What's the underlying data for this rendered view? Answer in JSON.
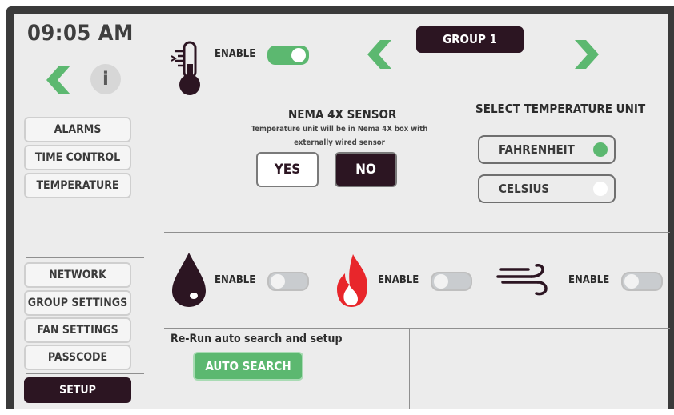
{
  "clock": "09:05 AM",
  "info_glyph": "i",
  "nav_top": [
    {
      "label": "ALARMS"
    },
    {
      "label": "TIME CONTROL"
    },
    {
      "label": "TEMPERATURE"
    }
  ],
  "nav_bottom": [
    {
      "label": "NETWORK"
    },
    {
      "label": "GROUP SETTINGS"
    },
    {
      "label": "FAN SETTINGS"
    },
    {
      "label": "PASSCODE"
    },
    {
      "label": "SETUP"
    }
  ],
  "temperature": {
    "enable_label": "ENABLE",
    "enabled": true,
    "icon": "thermometer-icon"
  },
  "group": {
    "label": "GROUP 1"
  },
  "nema": {
    "title": "NEMA 4X SENSOR",
    "description_line1": "Temperature unit will be in Nema 4X box with",
    "description_line2": "externally wired sensor",
    "yes_label": "YES",
    "no_label": "NO",
    "selected": "NO"
  },
  "temp_unit": {
    "title": "SELECT TEMPERATURE UNIT",
    "options": [
      {
        "label": "FAHRENHEIT",
        "selected": true
      },
      {
        "label": "CELSIUS",
        "selected": false
      }
    ]
  },
  "sensors": [
    {
      "icon": "water-drop-icon",
      "enable_label": "ENABLE",
      "enabled": false
    },
    {
      "icon": "flame-icon",
      "enable_label": "ENABLE",
      "enabled": false
    },
    {
      "icon": "wind-icon",
      "enable_label": "ENABLE",
      "enabled": false
    }
  ],
  "autosearch": {
    "heading": "Re-Run auto search and setup",
    "button_label": "AUTO SEARCH"
  },
  "colors": {
    "accent_green": "#5cb870",
    "dark_plum": "#2c1522",
    "flame_red": "#e8262b"
  }
}
